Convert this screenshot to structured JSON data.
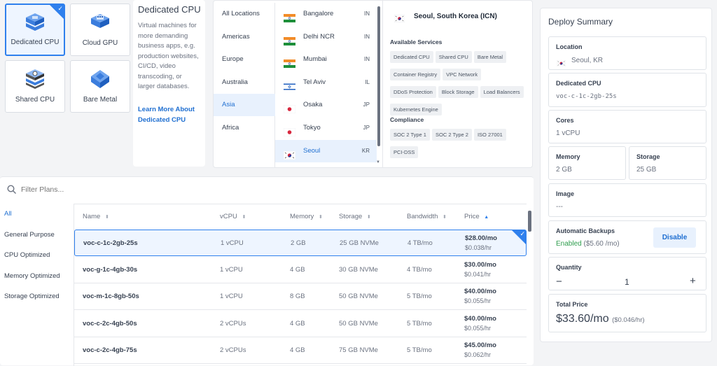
{
  "types": [
    {
      "id": "dedicated",
      "label": "Dedicated CPU",
      "selected": true
    },
    {
      "id": "cloudgpu",
      "label": "Cloud GPU",
      "selected": false
    },
    {
      "id": "shared",
      "label": "Shared CPU",
      "selected": false
    },
    {
      "id": "baremetal",
      "label": "Bare Metal",
      "selected": false
    }
  ],
  "description": {
    "title": "Dedicated CPU",
    "lines": [
      "Virtual machines for",
      "more demanding",
      "business apps, e.g.",
      "production websites,",
      "CI/CD, video",
      "transcoding, or",
      "larger databases."
    ],
    "link1": "Learn More About",
    "link2": "Dedicated CPU"
  },
  "regions": [
    "All Locations",
    "Americas",
    "Europe",
    "Australia",
    "Asia",
    "Africa"
  ],
  "selected_region": "Asia",
  "cities": [
    {
      "name": "Bangalore",
      "code": "IN",
      "flag": "in"
    },
    {
      "name": "Delhi NCR",
      "code": "IN",
      "flag": "in"
    },
    {
      "name": "Mumbai",
      "code": "IN",
      "flag": "in"
    },
    {
      "name": "Tel Aviv",
      "code": "IL",
      "flag": "il"
    },
    {
      "name": "Osaka",
      "code": "JP",
      "flag": "jp"
    },
    {
      "name": "Tokyo",
      "code": "JP",
      "flag": "jp"
    },
    {
      "name": "Seoul",
      "code": "KR",
      "flag": "kr",
      "selected": true
    }
  ],
  "location_detail": {
    "title": "Seoul, South Korea (ICN)",
    "services_label": "Available Services",
    "services": [
      "Dedicated CPU",
      "Shared CPU",
      "Bare Metal",
      "Container Registry",
      "VPC Network",
      "DDoS Protection",
      "Block Storage",
      "Load Balancers",
      "Kubernetes Engine"
    ],
    "compliance_label": "Compliance",
    "compliance": [
      "SOC 2 Type 1",
      "SOC 2 Type 2",
      "ISO 27001",
      "PCI-DSS"
    ]
  },
  "filter": {
    "placeholder": "Filter Plans..."
  },
  "categories": [
    "All",
    "General Purpose",
    "CPU Optimized",
    "Memory Optimized",
    "Storage Optimized"
  ],
  "selected_category": "All",
  "columns": [
    "Name",
    "vCPU",
    "Memory",
    "Storage",
    "Bandwidth",
    "Price"
  ],
  "plans": [
    {
      "name": "voc-c-1c-2gb-25s",
      "vcpu": "1 vCPU",
      "memory": "2 GB",
      "storage": "25 GB NVMe",
      "bandwidth": "4 TB/mo",
      "price": "$28.00/mo",
      "hourly": "$0.038/hr",
      "selected": true
    },
    {
      "name": "voc-g-1c-4gb-30s",
      "vcpu": "1 vCPU",
      "memory": "4 GB",
      "storage": "30 GB NVMe",
      "bandwidth": "4 TB/mo",
      "price": "$30.00/mo",
      "hourly": "$0.041/hr"
    },
    {
      "name": "voc-m-1c-8gb-50s",
      "vcpu": "1 vCPU",
      "memory": "8 GB",
      "storage": "50 GB NVMe",
      "bandwidth": "5 TB/mo",
      "price": "$40.00/mo",
      "hourly": "$0.055/hr"
    },
    {
      "name": "voc-c-2c-4gb-50s",
      "vcpu": "2 vCPUs",
      "memory": "4 GB",
      "storage": "50 GB NVMe",
      "bandwidth": "5 TB/mo",
      "price": "$40.00/mo",
      "hourly": "$0.055/hr"
    },
    {
      "name": "voc-c-2c-4gb-75s",
      "vcpu": "2 vCPUs",
      "memory": "4 GB",
      "storage": "75 GB NVMe",
      "bandwidth": "5 TB/mo",
      "price": "$45.00/mo",
      "hourly": "$0.062/hr"
    }
  ],
  "summary": {
    "title": "Deploy Summary",
    "location_label": "Location",
    "location_value": "Seoul, KR",
    "plan_label": "Dedicated CPU",
    "plan_value": "voc-c-1c-2gb-25s",
    "cores_label": "Cores",
    "cores_value": "1 vCPU",
    "memory_label": "Memory",
    "memory_value": "2 GB",
    "storage_label": "Storage",
    "storage_value": "25 GB",
    "image_label": "Image",
    "image_value": "---",
    "backups_label": "Automatic Backups",
    "backups_status": "Enabled",
    "backups_price": "($5.60 /mo)",
    "backups_button": "Disable",
    "quantity_label": "Quantity",
    "quantity_value": "1",
    "minus": "−",
    "plus": "+",
    "total_label": "Total Price",
    "total_value": "$33.60/mo",
    "total_hourly": "($0.046/hr)"
  },
  "colors": {
    "accent": "#2f80ed",
    "link": "#1f6fd1",
    "enabled": "#2e9d4d"
  }
}
